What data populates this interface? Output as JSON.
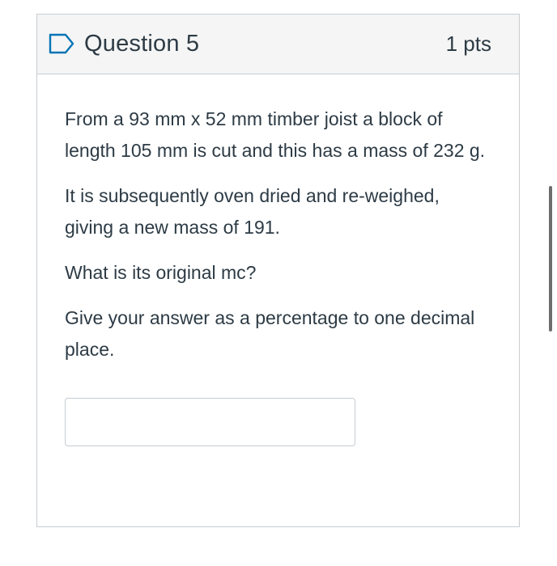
{
  "question": {
    "title": "Question 5",
    "points": "1 pts",
    "flag_icon": "bookmark-flag-icon",
    "paragraphs": [
      "From a 93 mm x 52 mm timber joist a block of length 105 mm is cut and this has a mass of 232 g.",
      "It is subsequently oven dried and re-weighed, giving a new mass of 191.",
      "What is its original mc?",
      "Give your answer as a percentage to one decimal place."
    ],
    "answer": {
      "value": "",
      "placeholder": ""
    }
  },
  "colors": {
    "text": "#2d3b45",
    "border": "#c7cdd1",
    "header_bg": "#f5f5f5",
    "flag_stroke": "#0374b5"
  }
}
